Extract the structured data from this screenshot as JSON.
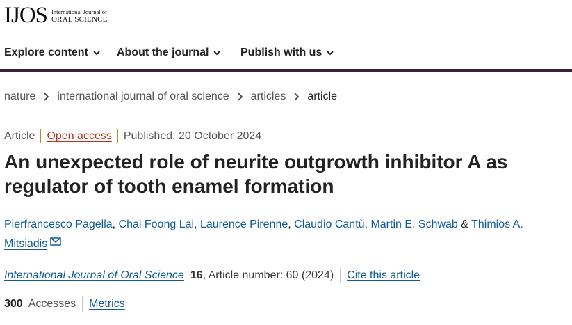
{
  "header": {
    "logo_main": "IJOS",
    "logo_line1": "International Journal of",
    "logo_line2": "ORAL SCIENCE"
  },
  "nav": {
    "items": [
      {
        "label": "Explore content"
      },
      {
        "label": "About the journal"
      },
      {
        "label": "Publish with us"
      }
    ]
  },
  "breadcrumb": {
    "items": [
      "nature",
      "international journal of oral science",
      "articles"
    ],
    "current": "article"
  },
  "meta": {
    "type": "Article",
    "access": "Open access",
    "published": "Published: 20 October 2024"
  },
  "article": {
    "title": "An unexpected role of neurite outgrowth inhibitor A as regulator of tooth enamel formation",
    "authors": [
      "Pierfrancesco Pagella",
      "Chai Foong Lai",
      "Laurence Pirenne",
      "Claudio Cantù",
      "Martin E. Schwab",
      "Thimios A. Mitsiadis"
    ],
    "author_sep": ", ",
    "author_amp": " & "
  },
  "citation": {
    "journal": "International Journal of Oral Science",
    "volume": "16",
    "rest": ", Article number: 60 (2024)",
    "cite_label": "Cite this article"
  },
  "metrics": {
    "count": "300",
    "accesses_label": "Accesses",
    "metrics_label": "Metrics"
  },
  "colors": {
    "nav_border": "#3c1d37",
    "link": "#0f5b96",
    "open_access": "#b4341c"
  }
}
